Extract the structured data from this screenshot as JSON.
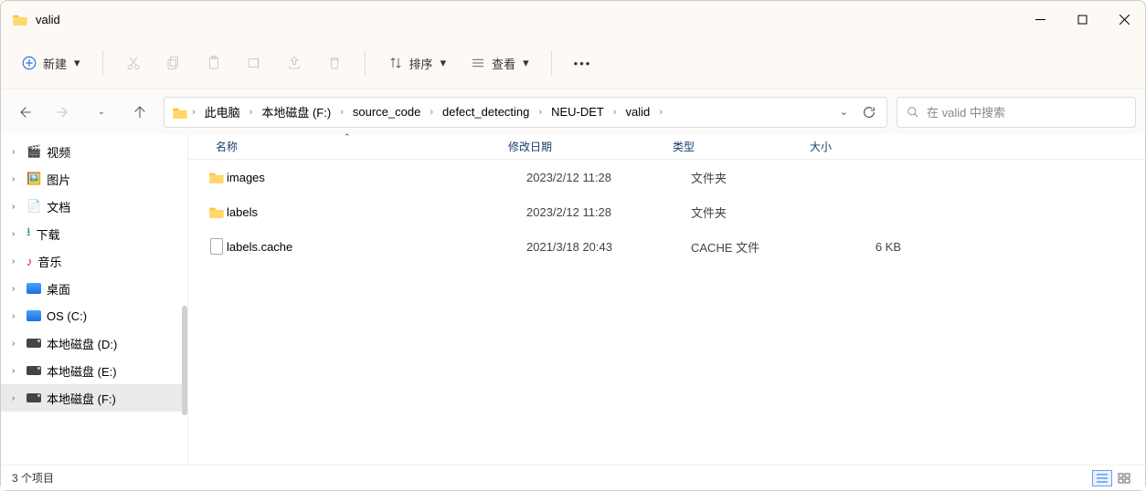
{
  "window": {
    "title": "valid"
  },
  "toolbar": {
    "new": "新建",
    "sort": "排序",
    "view": "查看"
  },
  "breadcrumbs": {
    "b0": "此电脑",
    "b1": "本地磁盘 (F:)",
    "b2": "source_code",
    "b3": "defect_detecting",
    "b4": "NEU-DET",
    "b5": "valid"
  },
  "search": {
    "placeholder": "在 valid 中搜索"
  },
  "columns": {
    "name": "名称",
    "date": "修改日期",
    "type": "类型",
    "size": "大小"
  },
  "sidebar": {
    "i0": "视频",
    "i1": "图片",
    "i2": "文档",
    "i3": "下载",
    "i4": "音乐",
    "i5": "桌面",
    "i6": "OS (C:)",
    "i7": "本地磁盘 (D:)",
    "i8": "本地磁盘 (E:)",
    "i9": "本地磁盘 (F:)"
  },
  "files": {
    "r0": {
      "name": "images",
      "date": "2023/2/12 11:28",
      "type": "文件夹",
      "size": ""
    },
    "r1": {
      "name": "labels",
      "date": "2023/2/12 11:28",
      "type": "文件夹",
      "size": ""
    },
    "r2": {
      "name": "labels.cache",
      "date": "2021/3/18 20:43",
      "type": "CACHE 文件",
      "size": "6 KB"
    }
  },
  "status": {
    "count": "3 个项目"
  }
}
